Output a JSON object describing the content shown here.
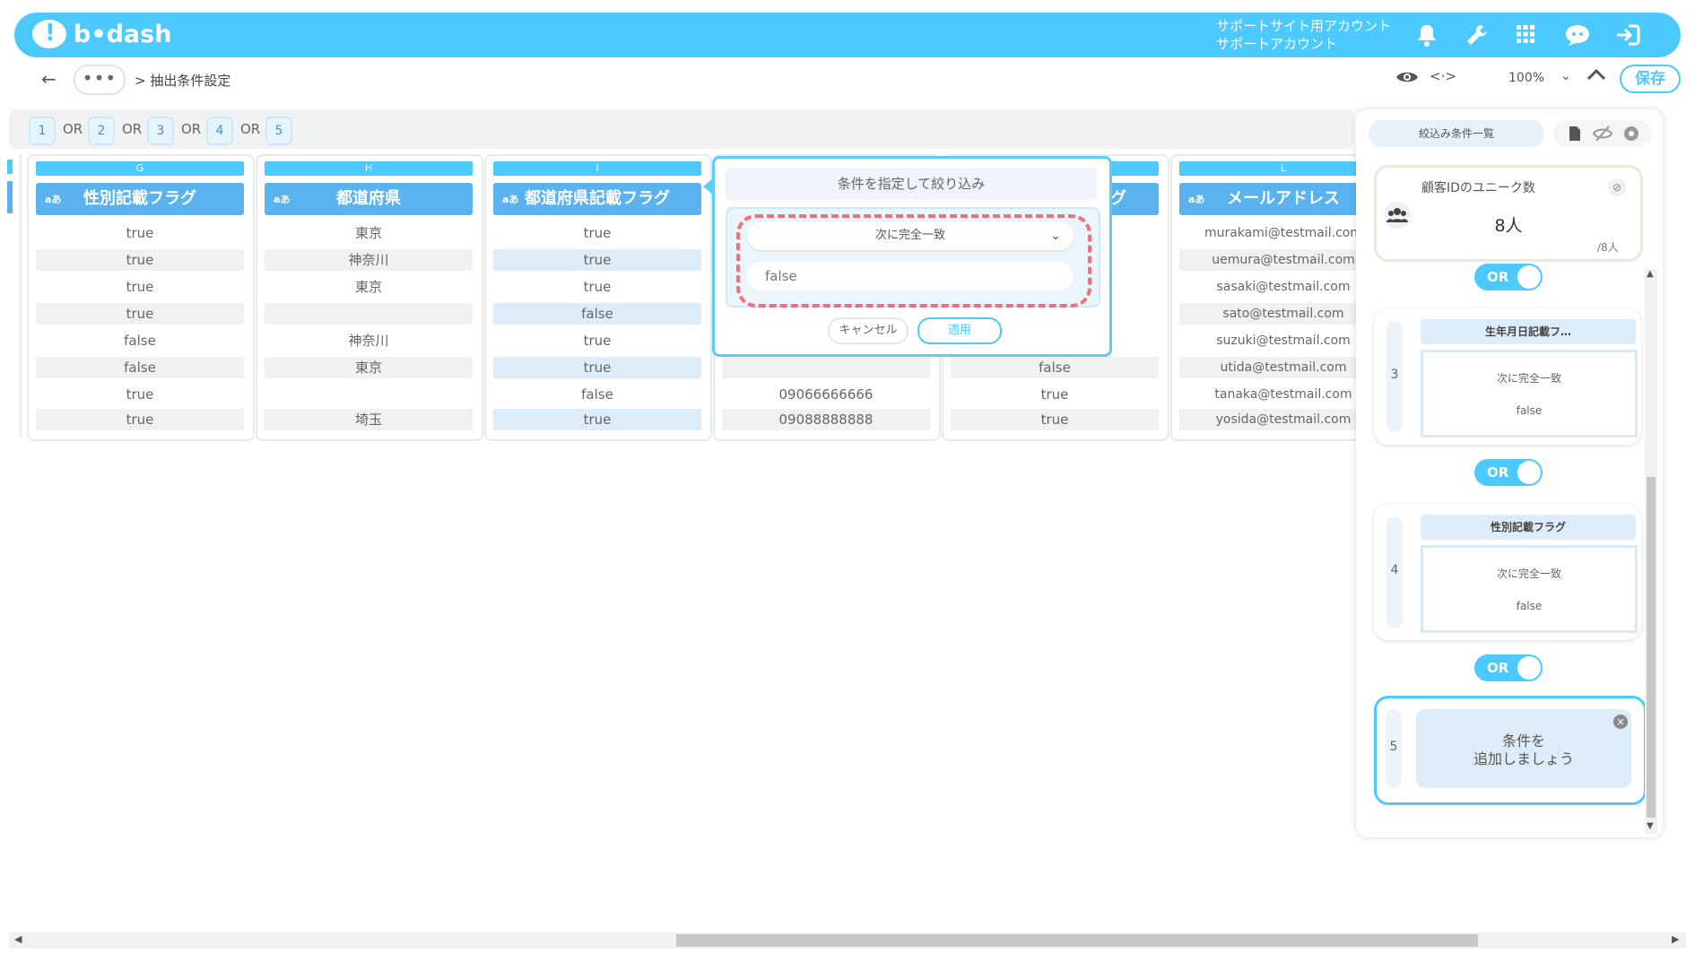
{
  "header": {
    "logo_text": "b•dash",
    "account_line1": "サポートサイト用アカウント",
    "account_line2": "サポートアカウント",
    "icons": [
      "bell-icon",
      "wrench-icon",
      "grid-icon",
      "chat-icon",
      "logout-icon"
    ]
  },
  "subbar": {
    "dots": "•••",
    "breadcrumb": "> 抽出条件設定",
    "zoom": "100%",
    "save_label": "保存"
  },
  "or_chain": {
    "chips": [
      "1",
      "2",
      "3",
      "4",
      "5"
    ],
    "connector": "OR"
  },
  "columns": [
    {
      "letter": "G",
      "type_badge": "aあ",
      "name": "性別記載フラグ",
      "cells": [
        "true",
        "true",
        "true",
        "true",
        "false",
        "false",
        "true",
        "true"
      ]
    },
    {
      "letter": "H",
      "type_badge": "aあ",
      "name": "都道府県",
      "cells": [
        "東京",
        "神奈川",
        "東京",
        "",
        "神奈川",
        "東京",
        "",
        "埼玉"
      ]
    },
    {
      "letter": "I",
      "type_badge": "aあ",
      "name": "都道府県記載フラグ",
      "cells": [
        "true",
        "true",
        "true",
        "false",
        "true",
        "true",
        "false",
        "true"
      ]
    },
    {
      "letter": "",
      "type_badge": "",
      "name": "",
      "cells": [
        "",
        "",
        "",
        "",
        "",
        "",
        "09066666666",
        "09088888888"
      ]
    },
    {
      "letter": "",
      "type_badge": "",
      "name": "グ",
      "cells": [
        "",
        "",
        "",
        "",
        "",
        "false",
        "true",
        "true"
      ]
    },
    {
      "letter": "L",
      "type_badge": "aあ",
      "name": "メールアドレス",
      "cells": [
        "murakami@testmail.com",
        "uemura@testmail.com",
        "sasaki@testmail.com",
        "sato@testmail.com",
        "suzuki@testmail.com",
        "utida@testmail.com",
        "tanaka@testmail.com",
        "yosida@testmail.com"
      ]
    }
  ],
  "popup": {
    "title": "条件を指定して絞り込み",
    "operator": "次に完全一致",
    "value": "false",
    "cancel_label": "キャンセル",
    "apply_label": "適用"
  },
  "panel": {
    "tab_label": "絞込み条件一覧",
    "unique_title": "顧客IDのユニーク数",
    "unique_count": "8人",
    "unique_total": "/8人",
    "toggle_label": "OR",
    "conditions": [
      {
        "num": "3",
        "field": "生年月日記載フ…",
        "operator": "次に完全一致",
        "value": "false"
      },
      {
        "num": "4",
        "field": "性別記載フラグ",
        "operator": "次に完全一致",
        "value": "false"
      }
    ],
    "add_num": "5",
    "add_label_line1": "条件を",
    "add_label_line2": "追加しましょう"
  }
}
